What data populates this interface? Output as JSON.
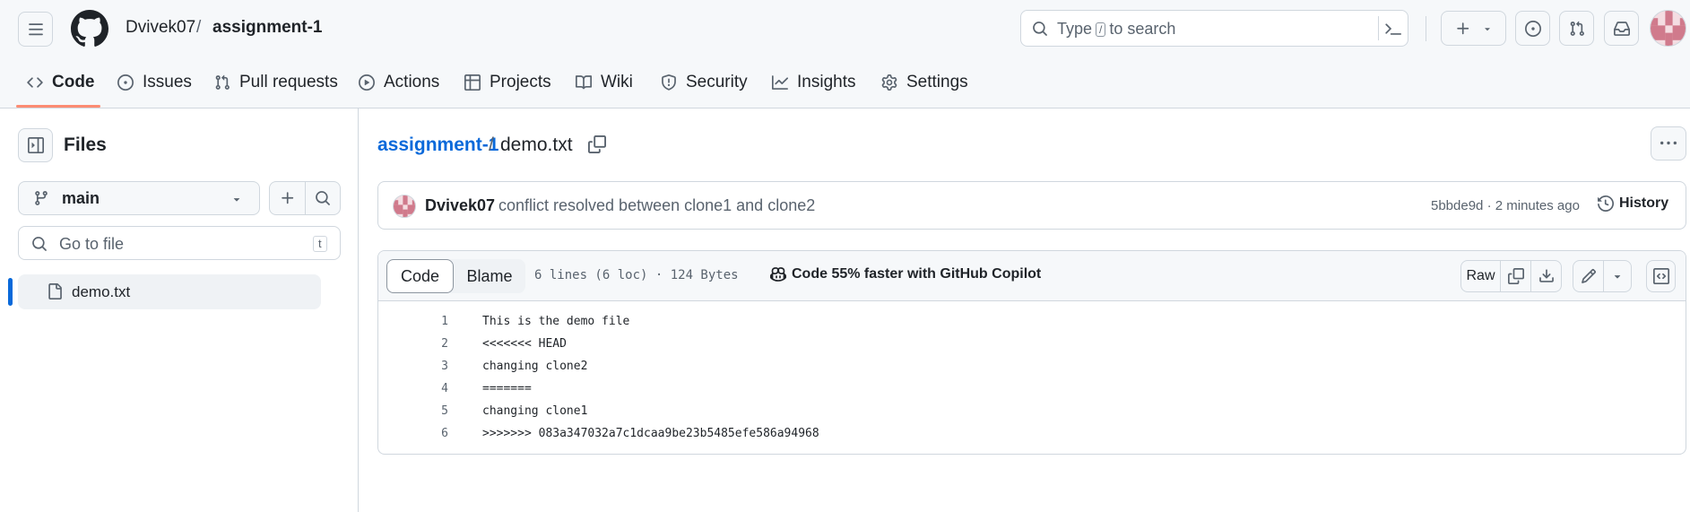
{
  "header": {
    "owner": "Dvivek07",
    "separator": "/",
    "repo": "assignment-1",
    "search": {
      "before": "Type",
      "key": "/",
      "after": "to search"
    }
  },
  "tabs": [
    {
      "label": "Code"
    },
    {
      "label": "Issues"
    },
    {
      "label": "Pull requests"
    },
    {
      "label": "Actions"
    },
    {
      "label": "Projects"
    },
    {
      "label": "Wiki"
    },
    {
      "label": "Security"
    },
    {
      "label": "Insights"
    },
    {
      "label": "Settings"
    }
  ],
  "sidebar": {
    "title": "Files",
    "branch": "main",
    "go_to_file_placeholder": "Go to file",
    "go_to_file_key": "t",
    "files": [
      {
        "name": "demo.txt"
      }
    ]
  },
  "path": {
    "repo": "assignment-1",
    "separator": "/",
    "file": "demo.txt"
  },
  "commit": {
    "author": "Dvivek07",
    "message": "conflict resolved between clone1 and clone2",
    "sha_time": "5bbde9d · 2 minutes ago",
    "history_label": "History"
  },
  "file": {
    "code_tab": "Code",
    "blame_tab": "Blame",
    "meta": "6 lines (6 loc) · 124 Bytes",
    "copilot": "Code 55% faster with GitHub Copilot",
    "raw_label": "Raw",
    "lines": [
      {
        "n": "1",
        "text": "This is the demo file"
      },
      {
        "n": "2",
        "text": "<<<<<<< HEAD"
      },
      {
        "n": "3",
        "text": "changing clone2"
      },
      {
        "n": "4",
        "text": "======="
      },
      {
        "n": "5",
        "text": "changing clone1"
      },
      {
        "n": "6",
        "text": ">>>>>>> 083a347032a7c1dcaa9be23b5485efe586a94968"
      }
    ]
  },
  "colors": {
    "accent_link": "#0969da",
    "tab_underline": "#fd8c73",
    "border": "#d0d7de",
    "avatar_pink": "#d07a8c"
  },
  "icons": {
    "menu": "hamburger-icon",
    "logo": "github-mark-icon",
    "search": "search-icon",
    "terminal": "command-palette-icon",
    "plus": "plus-icon",
    "issues": "issue-opened-icon",
    "pulls": "git-pull-request-icon",
    "inbox": "inbox-icon",
    "history": "history-icon",
    "copy": "copy-icon",
    "download": "download-icon",
    "pencil": "pencil-icon",
    "symbols": "code-square-icon"
  }
}
